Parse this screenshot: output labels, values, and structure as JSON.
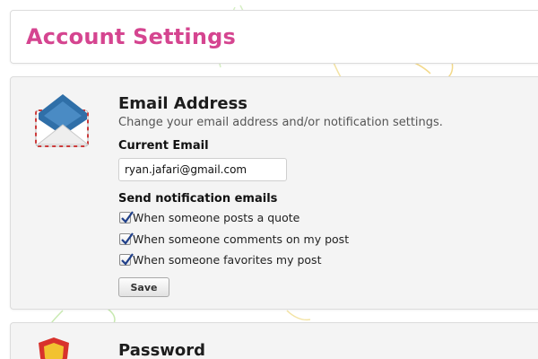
{
  "header": {
    "title": "Account Settings"
  },
  "email_section": {
    "icon": "envelope-icon",
    "title": "Email Address",
    "description": "Change your email address and/or notification settings.",
    "current_email_label": "Current Email",
    "current_email_value": "ryan.jafari@gmail.com",
    "notifications_label": "Send notification emails",
    "options": [
      {
        "label": "When someone posts a quote",
        "checked": true
      },
      {
        "label": "When someone comments on my post",
        "checked": true
      },
      {
        "label": "When someone favorites my post",
        "checked": true
      }
    ],
    "save_label": "Save"
  },
  "password_section": {
    "icon": "shield-icon",
    "title": "Password"
  },
  "colors": {
    "title_accent": "#d54590",
    "envelope_blue": "#2f6fa8",
    "shield_red": "#d8322c",
    "shield_gold": "#f2c230",
    "doodle_yellow": "#f3d98a",
    "doodle_green": "#bfe3a4"
  }
}
